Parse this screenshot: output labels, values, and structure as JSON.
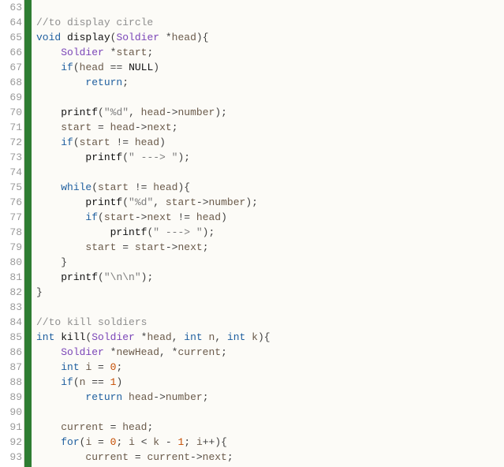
{
  "editor": {
    "first_line_number": 63,
    "lines": [
      {
        "n": 63,
        "tokens": []
      },
      {
        "n": 64,
        "tokens": [
          {
            "cls": "tok-comment",
            "t": "//to display circle"
          }
        ]
      },
      {
        "n": 65,
        "tokens": [
          {
            "cls": "tok-kw",
            "t": "void"
          },
          {
            "cls": "tok-punc",
            "t": " "
          },
          {
            "cls": "tok-fn",
            "t": "display"
          },
          {
            "cls": "tok-punc",
            "t": "("
          },
          {
            "cls": "tok-type",
            "t": "Soldier"
          },
          {
            "cls": "tok-punc",
            "t": " *"
          },
          {
            "cls": "tok-ident",
            "t": "head"
          },
          {
            "cls": "tok-punc",
            "t": "){"
          }
        ]
      },
      {
        "n": 66,
        "tokens": [
          {
            "cls": "tok-punc",
            "t": "    "
          },
          {
            "cls": "tok-type",
            "t": "Soldier"
          },
          {
            "cls": "tok-punc",
            "t": " *"
          },
          {
            "cls": "tok-ident",
            "t": "start"
          },
          {
            "cls": "tok-punc",
            "t": ";"
          }
        ]
      },
      {
        "n": 67,
        "tokens": [
          {
            "cls": "tok-punc",
            "t": "    "
          },
          {
            "cls": "tok-kw",
            "t": "if"
          },
          {
            "cls": "tok-punc",
            "t": "("
          },
          {
            "cls": "tok-ident",
            "t": "head"
          },
          {
            "cls": "tok-punc",
            "t": " == "
          },
          {
            "cls": "tok-const",
            "t": "NULL"
          },
          {
            "cls": "tok-punc",
            "t": ")"
          }
        ]
      },
      {
        "n": 68,
        "tokens": [
          {
            "cls": "tok-punc",
            "t": "        "
          },
          {
            "cls": "tok-kw",
            "t": "return"
          },
          {
            "cls": "tok-punc",
            "t": ";"
          }
        ]
      },
      {
        "n": 69,
        "tokens": []
      },
      {
        "n": 70,
        "tokens": [
          {
            "cls": "tok-punc",
            "t": "    "
          },
          {
            "cls": "tok-fn",
            "t": "printf"
          },
          {
            "cls": "tok-punc",
            "t": "("
          },
          {
            "cls": "tok-str",
            "t": "\"%d\""
          },
          {
            "cls": "tok-punc",
            "t": ", "
          },
          {
            "cls": "tok-ident",
            "t": "head"
          },
          {
            "cls": "tok-punc",
            "t": "->"
          },
          {
            "cls": "tok-ident",
            "t": "number"
          },
          {
            "cls": "tok-punc",
            "t": ");"
          }
        ]
      },
      {
        "n": 71,
        "tokens": [
          {
            "cls": "tok-punc",
            "t": "    "
          },
          {
            "cls": "tok-ident",
            "t": "start"
          },
          {
            "cls": "tok-punc",
            "t": " = "
          },
          {
            "cls": "tok-ident",
            "t": "head"
          },
          {
            "cls": "tok-punc",
            "t": "->"
          },
          {
            "cls": "tok-ident",
            "t": "next"
          },
          {
            "cls": "tok-punc",
            "t": ";"
          }
        ]
      },
      {
        "n": 72,
        "tokens": [
          {
            "cls": "tok-punc",
            "t": "    "
          },
          {
            "cls": "tok-kw",
            "t": "if"
          },
          {
            "cls": "tok-punc",
            "t": "("
          },
          {
            "cls": "tok-ident",
            "t": "start"
          },
          {
            "cls": "tok-punc",
            "t": " != "
          },
          {
            "cls": "tok-ident",
            "t": "head"
          },
          {
            "cls": "tok-punc",
            "t": ")"
          }
        ]
      },
      {
        "n": 73,
        "tokens": [
          {
            "cls": "tok-punc",
            "t": "        "
          },
          {
            "cls": "tok-fn",
            "t": "printf"
          },
          {
            "cls": "tok-punc",
            "t": "("
          },
          {
            "cls": "tok-str",
            "t": "\" ---> \""
          },
          {
            "cls": "tok-punc",
            "t": ");"
          }
        ]
      },
      {
        "n": 74,
        "tokens": []
      },
      {
        "n": 75,
        "tokens": [
          {
            "cls": "tok-punc",
            "t": "    "
          },
          {
            "cls": "tok-kw",
            "t": "while"
          },
          {
            "cls": "tok-punc",
            "t": "("
          },
          {
            "cls": "tok-ident",
            "t": "start"
          },
          {
            "cls": "tok-punc",
            "t": " != "
          },
          {
            "cls": "tok-ident",
            "t": "head"
          },
          {
            "cls": "tok-punc",
            "t": "){"
          }
        ]
      },
      {
        "n": 76,
        "tokens": [
          {
            "cls": "tok-punc",
            "t": "        "
          },
          {
            "cls": "tok-fn",
            "t": "printf"
          },
          {
            "cls": "tok-punc",
            "t": "("
          },
          {
            "cls": "tok-str",
            "t": "\"%d\""
          },
          {
            "cls": "tok-punc",
            "t": ", "
          },
          {
            "cls": "tok-ident",
            "t": "start"
          },
          {
            "cls": "tok-punc",
            "t": "->"
          },
          {
            "cls": "tok-ident",
            "t": "number"
          },
          {
            "cls": "tok-punc",
            "t": ");"
          }
        ]
      },
      {
        "n": 77,
        "tokens": [
          {
            "cls": "tok-punc",
            "t": "        "
          },
          {
            "cls": "tok-kw",
            "t": "if"
          },
          {
            "cls": "tok-punc",
            "t": "("
          },
          {
            "cls": "tok-ident",
            "t": "start"
          },
          {
            "cls": "tok-punc",
            "t": "->"
          },
          {
            "cls": "tok-ident",
            "t": "next"
          },
          {
            "cls": "tok-punc",
            "t": " != "
          },
          {
            "cls": "tok-ident",
            "t": "head"
          },
          {
            "cls": "tok-punc",
            "t": ")"
          }
        ]
      },
      {
        "n": 78,
        "tokens": [
          {
            "cls": "tok-punc",
            "t": "            "
          },
          {
            "cls": "tok-fn",
            "t": "printf"
          },
          {
            "cls": "tok-punc",
            "t": "("
          },
          {
            "cls": "tok-str",
            "t": "\" ---> \""
          },
          {
            "cls": "tok-punc",
            "t": ");"
          }
        ]
      },
      {
        "n": 79,
        "tokens": [
          {
            "cls": "tok-punc",
            "t": "        "
          },
          {
            "cls": "tok-ident",
            "t": "start"
          },
          {
            "cls": "tok-punc",
            "t": " = "
          },
          {
            "cls": "tok-ident",
            "t": "start"
          },
          {
            "cls": "tok-punc",
            "t": "->"
          },
          {
            "cls": "tok-ident",
            "t": "next"
          },
          {
            "cls": "tok-punc",
            "t": ";"
          }
        ]
      },
      {
        "n": 80,
        "tokens": [
          {
            "cls": "tok-punc",
            "t": "    }"
          }
        ]
      },
      {
        "n": 81,
        "tokens": [
          {
            "cls": "tok-punc",
            "t": "    "
          },
          {
            "cls": "tok-fn",
            "t": "printf"
          },
          {
            "cls": "tok-punc",
            "t": "("
          },
          {
            "cls": "tok-str",
            "t": "\"\\n\\n\""
          },
          {
            "cls": "tok-punc",
            "t": ");"
          }
        ]
      },
      {
        "n": 82,
        "tokens": [
          {
            "cls": "tok-punc",
            "t": "}"
          }
        ]
      },
      {
        "n": 83,
        "tokens": []
      },
      {
        "n": 84,
        "tokens": [
          {
            "cls": "tok-comment",
            "t": "//to kill soldiers"
          }
        ]
      },
      {
        "n": 85,
        "tokens": [
          {
            "cls": "tok-kw",
            "t": "int"
          },
          {
            "cls": "tok-punc",
            "t": " "
          },
          {
            "cls": "tok-fn",
            "t": "kill"
          },
          {
            "cls": "tok-punc",
            "t": "("
          },
          {
            "cls": "tok-type",
            "t": "Soldier"
          },
          {
            "cls": "tok-punc",
            "t": " *"
          },
          {
            "cls": "tok-ident",
            "t": "head"
          },
          {
            "cls": "tok-punc",
            "t": ", "
          },
          {
            "cls": "tok-kw",
            "t": "int"
          },
          {
            "cls": "tok-punc",
            "t": " "
          },
          {
            "cls": "tok-ident",
            "t": "n"
          },
          {
            "cls": "tok-punc",
            "t": ", "
          },
          {
            "cls": "tok-kw",
            "t": "int"
          },
          {
            "cls": "tok-punc",
            "t": " "
          },
          {
            "cls": "tok-ident",
            "t": "k"
          },
          {
            "cls": "tok-punc",
            "t": "){"
          }
        ]
      },
      {
        "n": 86,
        "tokens": [
          {
            "cls": "tok-punc",
            "t": "    "
          },
          {
            "cls": "tok-type",
            "t": "Soldier"
          },
          {
            "cls": "tok-punc",
            "t": " *"
          },
          {
            "cls": "tok-ident",
            "t": "newHead"
          },
          {
            "cls": "tok-punc",
            "t": ", *"
          },
          {
            "cls": "tok-ident",
            "t": "current"
          },
          {
            "cls": "tok-punc",
            "t": ";"
          }
        ]
      },
      {
        "n": 87,
        "tokens": [
          {
            "cls": "tok-punc",
            "t": "    "
          },
          {
            "cls": "tok-kw",
            "t": "int"
          },
          {
            "cls": "tok-punc",
            "t": " "
          },
          {
            "cls": "tok-ident",
            "t": "i"
          },
          {
            "cls": "tok-punc",
            "t": " = "
          },
          {
            "cls": "tok-num",
            "t": "0"
          },
          {
            "cls": "tok-punc",
            "t": ";"
          }
        ]
      },
      {
        "n": 88,
        "tokens": [
          {
            "cls": "tok-punc",
            "t": "    "
          },
          {
            "cls": "tok-kw",
            "t": "if"
          },
          {
            "cls": "tok-punc",
            "t": "("
          },
          {
            "cls": "tok-ident",
            "t": "n"
          },
          {
            "cls": "tok-punc",
            "t": " == "
          },
          {
            "cls": "tok-num",
            "t": "1"
          },
          {
            "cls": "tok-punc",
            "t": ")"
          }
        ]
      },
      {
        "n": 89,
        "tokens": [
          {
            "cls": "tok-punc",
            "t": "        "
          },
          {
            "cls": "tok-kw",
            "t": "return"
          },
          {
            "cls": "tok-punc",
            "t": " "
          },
          {
            "cls": "tok-ident",
            "t": "head"
          },
          {
            "cls": "tok-punc",
            "t": "->"
          },
          {
            "cls": "tok-ident",
            "t": "number"
          },
          {
            "cls": "tok-punc",
            "t": ";"
          }
        ]
      },
      {
        "n": 90,
        "tokens": []
      },
      {
        "n": 91,
        "tokens": [
          {
            "cls": "tok-punc",
            "t": "    "
          },
          {
            "cls": "tok-ident",
            "t": "current"
          },
          {
            "cls": "tok-punc",
            "t": " = "
          },
          {
            "cls": "tok-ident",
            "t": "head"
          },
          {
            "cls": "tok-punc",
            "t": ";"
          }
        ]
      },
      {
        "n": 92,
        "tokens": [
          {
            "cls": "tok-punc",
            "t": "    "
          },
          {
            "cls": "tok-kw",
            "t": "for"
          },
          {
            "cls": "tok-punc",
            "t": "("
          },
          {
            "cls": "tok-ident",
            "t": "i"
          },
          {
            "cls": "tok-punc",
            "t": " = "
          },
          {
            "cls": "tok-num",
            "t": "0"
          },
          {
            "cls": "tok-punc",
            "t": "; "
          },
          {
            "cls": "tok-ident",
            "t": "i"
          },
          {
            "cls": "tok-punc",
            "t": " < "
          },
          {
            "cls": "tok-ident",
            "t": "k"
          },
          {
            "cls": "tok-punc",
            "t": " - "
          },
          {
            "cls": "tok-num",
            "t": "1"
          },
          {
            "cls": "tok-punc",
            "t": "; "
          },
          {
            "cls": "tok-ident",
            "t": "i"
          },
          {
            "cls": "tok-punc",
            "t": "++){"
          }
        ]
      },
      {
        "n": 93,
        "tokens": [
          {
            "cls": "tok-punc",
            "t": "        "
          },
          {
            "cls": "tok-ident",
            "t": "current"
          },
          {
            "cls": "tok-punc",
            "t": " = "
          },
          {
            "cls": "tok-ident",
            "t": "current"
          },
          {
            "cls": "tok-punc",
            "t": "->"
          },
          {
            "cls": "tok-ident",
            "t": "next"
          },
          {
            "cls": "tok-punc",
            "t": ";"
          }
        ]
      }
    ]
  }
}
